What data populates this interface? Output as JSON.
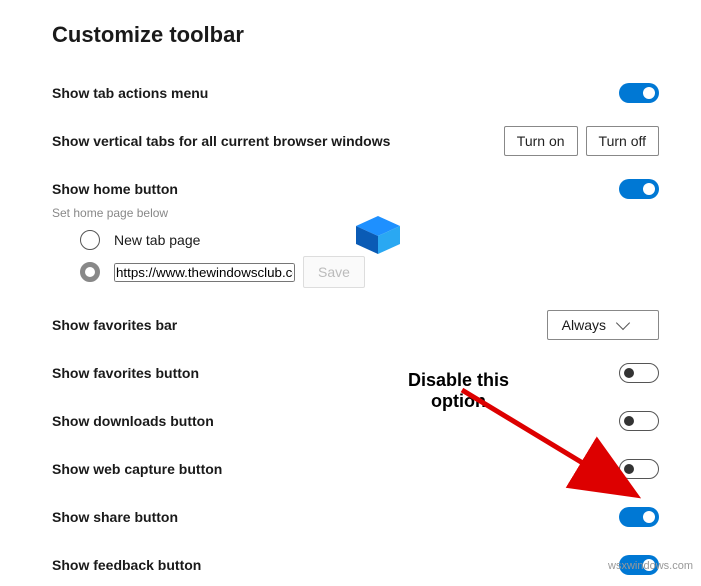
{
  "heading": "Customize toolbar",
  "rows": {
    "tabactions": {
      "label": "Show tab actions menu",
      "toggle": "on"
    },
    "verticaltabs": {
      "label": "Show vertical tabs for all current browser windows",
      "btn_on": "Turn on",
      "btn_off": "Turn off"
    },
    "homebutton": {
      "label": "Show home button",
      "toggle": "on",
      "subtext": "Set home page below"
    },
    "radio1": {
      "label": "New tab page"
    },
    "url_value": "https://www.thewindowsclub.com/",
    "save_label": "Save",
    "favoritesbar": {
      "label": "Show favorites bar",
      "dropdown": "Always"
    },
    "favoritesbtn": {
      "label": "Show favorites button",
      "toggle": "off"
    },
    "downloads": {
      "label": "Show downloads button",
      "toggle": "off"
    },
    "webcapture": {
      "label": "Show web capture button",
      "toggle": "off"
    },
    "share": {
      "label": "Show share button",
      "toggle": "on"
    },
    "feedback": {
      "label": "Show feedback button",
      "toggle": "on"
    }
  },
  "annotation": {
    "line1": "Disable this",
    "line2": "option"
  },
  "watermark": "wsxwindows.com"
}
